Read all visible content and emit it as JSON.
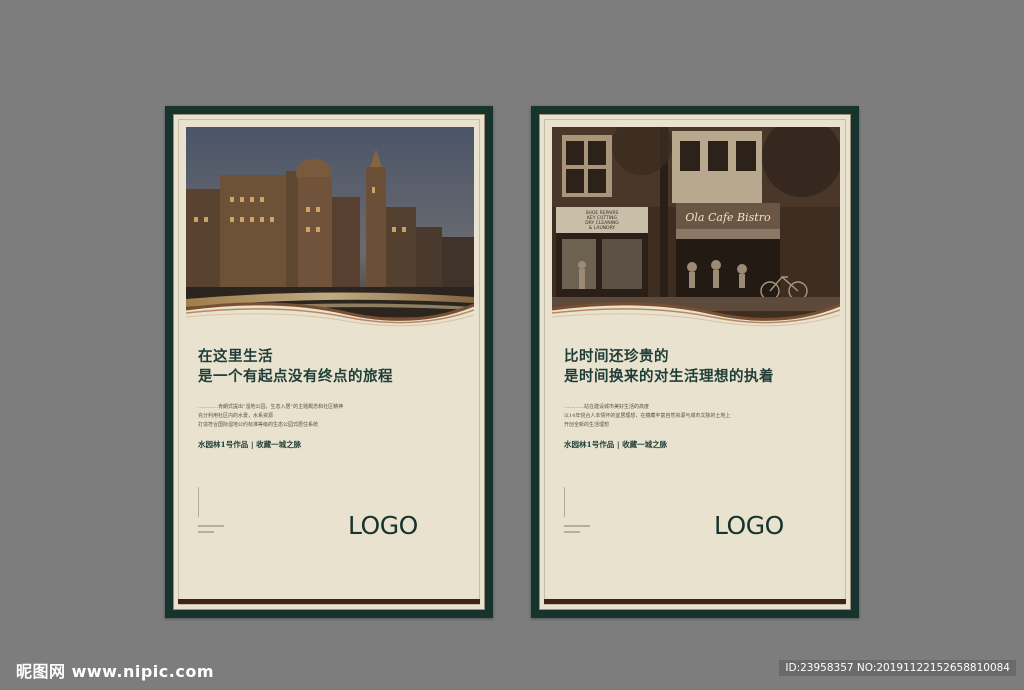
{
  "posters": [
    {
      "headline": [
        "在这里生活",
        "是一个有起点没有终点的旅程"
      ],
      "body": [
        "…………肯朗式提出“湿地公园，生态入居”的主题概念和社区精神",
        "充分利用社区内的水景，水系资源",
        "打造符合国际湿地公约标准等级的生态公园式居住系统"
      ],
      "tagline": "水园林1号作品 | 收藏一城之脉",
      "logo": "LOGO",
      "photo_icon": "city-night-photo"
    },
    {
      "headline": [
        "比时间还珍贵的",
        "是时间换来的对生活理想的执着"
      ],
      "body": [
        "…………站在建设城市美好生活的高度",
        "以14年悦合人本情怀的宜居理想，在蕴藏丰富自然资源与城市文脉的土地上",
        "开创全新的生活理想"
      ],
      "tagline": "水园林1号作品 | 收藏一城之脉",
      "logo": "LOGO",
      "photo_icon": "street-cafe-photo",
      "sign_cafe": "Ola Cafe Bistro",
      "sign_shop": [
        "SHOE REPAIRS",
        "KEY CUTTING",
        "DRY CLEANING",
        "& LAUNDRY"
      ]
    }
  ],
  "watermark": {
    "site": "昵图网 www.nipic.com",
    "id": "ID:23958357 NO:20191122152658810084"
  },
  "colors": {
    "frame": "#17332e",
    "paper": "#e8e2cf",
    "accent_text": "#1f3d37",
    "bar": "#3d2417"
  }
}
